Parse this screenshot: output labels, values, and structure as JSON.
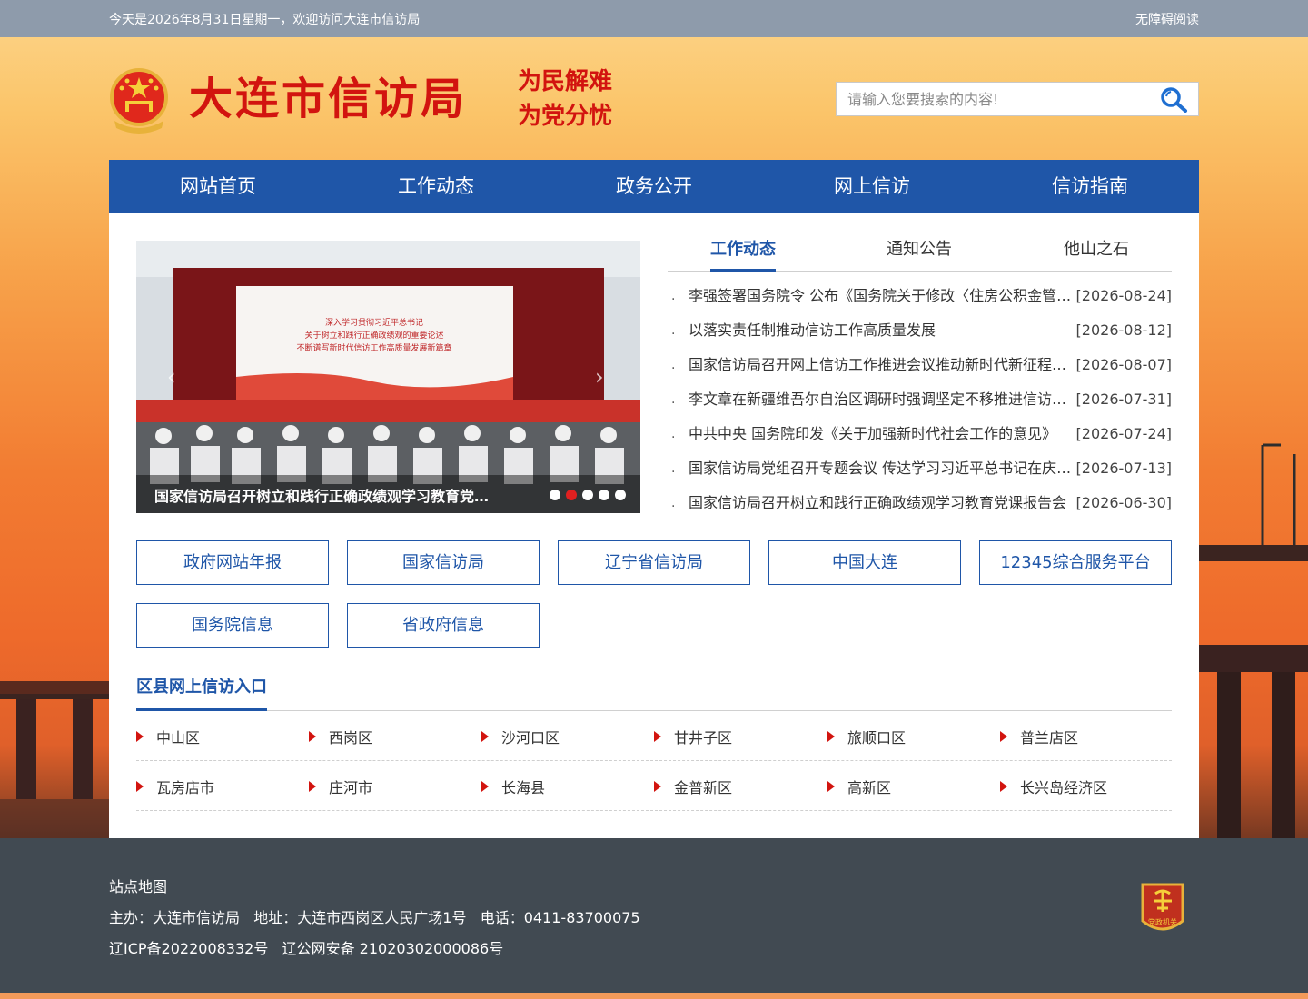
{
  "topbar": {
    "greeting": "今天是2026年8月31日星期一，欢迎访问大连市信访局",
    "accessibility": "无障碍阅读"
  },
  "header": {
    "title": "大连市信访局",
    "slogan_line1": "为民解难",
    "slogan_line2": "为党分忧",
    "search_placeholder": "请输入您要搜索的内容!"
  },
  "nav": [
    "网站首页",
    "工作动态",
    "政务公开",
    "网上信访",
    "信访指南"
  ],
  "slider": {
    "caption": "国家信访局召开树立和践行正确政绩观学习教育党课报告会",
    "slide_count": 5,
    "active_slide": 2,
    "banner_lines": [
      "深入学习贯彻习近平总书记",
      "关于树立和践行正确政绩观的重要论述",
      "不断谱写新时代信访工作高质量发展新篇章"
    ]
  },
  "tabs": [
    "工作动态",
    "通知公告",
    "他山之石"
  ],
  "news": [
    {
      "title": "李强签署国务院令 公布《国务院关于修改〈住房公积金管理条例〉的决定》",
      "date": "[2026-08-24]"
    },
    {
      "title": "以落实责任制推动信访工作高质量发展",
      "date": "[2026-08-12]"
    },
    {
      "title": "国家信访局召开网上信访工作推进会议推动新时代新征程网上信访工作",
      "date": "[2026-08-07]"
    },
    {
      "title": "李文章在新疆维吾尔自治区调研时强调坚定不移推进信访工作法治化",
      "date": "[2026-07-31]"
    },
    {
      "title": "中共中央 国务院印发《关于加强新时代社会工作的意见》",
      "date": "[2026-07-24]"
    },
    {
      "title": "国家信访局党组召开专题会议 传达学习习近平总书记在庆祝中国共产党成立重要讲话",
      "date": "[2026-07-13]"
    },
    {
      "title": "国家信访局召开树立和践行正确政绩观学习教育党课报告会",
      "date": "[2026-06-30]"
    }
  ],
  "links": [
    "政府网站年报",
    "国家信访局",
    "辽宁省信访局",
    "中国大连",
    "12345综合服务平台",
    "国务院信息",
    "省政府信息"
  ],
  "districts": {
    "heading": "区县网上信访入口",
    "row1": [
      "中山区",
      "西岗区",
      "沙河口区",
      "甘井子区",
      "旅顺口区",
      "普兰店区"
    ],
    "row2": [
      "瓦房店市",
      "庄河市",
      "长海县",
      "金普新区",
      "高新区",
      "长兴岛经济区"
    ]
  },
  "footer": {
    "sitemap": "站点地图",
    "contact": "主办：大连市信访局   地址：大连市西岗区人民广场1号   电话：0411-83700075",
    "icp": "辽ICP备2022008332号   辽公网安备 21020302000086号",
    "badge_text": "党政机关"
  },
  "colors": {
    "primary_blue": "#1f56a8",
    "title_red": "#d2140f",
    "topbar": "#8e9bab",
    "footer": "#414a52"
  },
  "icons": [
    "national-emblem-icon",
    "search-icon",
    "party-govt-badge-icon"
  ]
}
